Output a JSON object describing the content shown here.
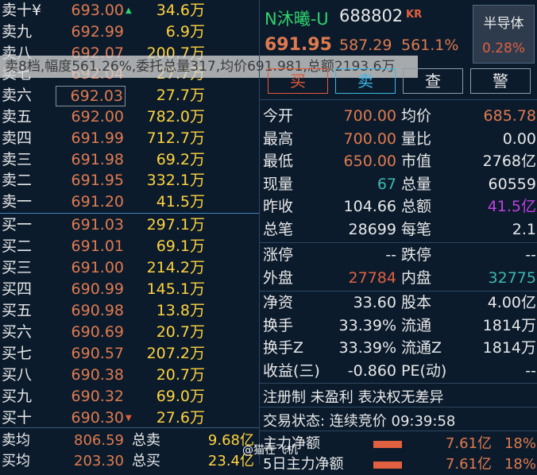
{
  "order_book": {
    "asks": [
      {
        "label": "卖十",
        "price": "693.00",
        "vol": "34.6万"
      },
      {
        "label": "卖九",
        "price": "692.99",
        "vol": "6.9万"
      },
      {
        "label": "卖八",
        "price": "692.07",
        "vol": "200.7万"
      },
      {
        "label": "卖七",
        "price": "692.04",
        "vol": "27.7万"
      },
      {
        "label": "卖六",
        "price": "692.03",
        "vol": "27.7万"
      },
      {
        "label": "卖五",
        "price": "692.00",
        "vol": "782.0万"
      },
      {
        "label": "卖四",
        "price": "691.99",
        "vol": "712.7万"
      },
      {
        "label": "卖三",
        "price": "691.98",
        "vol": "69.2万"
      },
      {
        "label": "卖二",
        "price": "691.95",
        "vol": "332.1万"
      },
      {
        "label": "卖一",
        "price": "691.20",
        "vol": "41.5万"
      }
    ],
    "bids": [
      {
        "label": "买一",
        "price": "691.03",
        "vol": "297.1万"
      },
      {
        "label": "买二",
        "price": "691.01",
        "vol": "69.1万"
      },
      {
        "label": "买三",
        "price": "691.00",
        "vol": "214.2万"
      },
      {
        "label": "买四",
        "price": "690.99",
        "vol": "145.1万"
      },
      {
        "label": "买五",
        "price": "690.98",
        "vol": "13.8万"
      },
      {
        "label": "买六",
        "price": "690.69",
        "vol": "20.7万"
      },
      {
        "label": "买七",
        "price": "690.57",
        "vol": "207.2万"
      },
      {
        "label": "买八",
        "price": "690.38",
        "vol": "20.7万"
      },
      {
        "label": "买九",
        "price": "690.32",
        "vol": "69.0万"
      },
      {
        "label": "买十",
        "price": "690.30",
        "vol": "27.6万"
      }
    ],
    "ask_top_suffix": "¥",
    "footer": [
      {
        "label": "卖均",
        "value": "806.59",
        "label2": "总卖",
        "value2": "9.68亿"
      },
      {
        "label": "买均",
        "value": "203.30",
        "label2": "总买",
        "value2": "23.4亿"
      }
    ]
  },
  "tooltip": "卖8档,幅度561.26%,委托总量317,均价691.981,总额2193.6万",
  "stock": {
    "name": "N沐曦-U",
    "code": "688802",
    "tag": "KR",
    "price": "691.95",
    "change": "587.29",
    "change_pct": "561.1%",
    "sector_name": "半导体",
    "sector_pct": "0.28%"
  },
  "buttons": {
    "buy": "买",
    "sell": "卖",
    "check": "查",
    "alert": "警"
  },
  "stats": [
    {
      "k1": "今开",
      "v1": "700.00",
      "c1": "#e07a4e",
      "k2": "均价",
      "v2": "685.78",
      "c2": "#e07a4e"
    },
    {
      "k1": "最高",
      "v1": "700.00",
      "c1": "#e07a4e",
      "k2": "量比",
      "v2": "0.00",
      "c2": "#e8e8e8"
    },
    {
      "k1": "最低",
      "v1": "650.00",
      "c1": "#e07a4e",
      "k2": "市值",
      "v2": "2768亿",
      "c2": "#e8e8e8"
    },
    {
      "k1": "现量",
      "v1": "67",
      "c1": "#3db7b0",
      "k2": "总量",
      "v2": "60559",
      "c2": "#e8e8e8"
    },
    {
      "k1": "昨收",
      "v1": "104.66",
      "c1": "#e8e8e8",
      "k2": "总额",
      "v2": "41.5亿",
      "c2": "#c040e0"
    },
    {
      "k1": "总笔",
      "v1": "28699",
      "c1": "#e8e8e8",
      "k2": "每笔",
      "v2": "2.1",
      "c2": "#e8e8e8"
    }
  ],
  "limits": [
    {
      "k1": "涨停",
      "v1": "--",
      "c1": "#e8e8e8",
      "k2": "跌停",
      "v2": "--",
      "c2": "#e8e8e8"
    },
    {
      "k1": "外盘",
      "v1": "27784",
      "c1": "#e0603f",
      "k2": "内盘",
      "v2": "32775",
      "c2": "#3db7b0"
    }
  ],
  "fundamentals": [
    {
      "k1": "净资",
      "v1": "33.60",
      "c1": "#e8e8e8",
      "k2": "股本",
      "v2": "4.00亿",
      "c2": "#e8e8e8"
    },
    {
      "k1": "换手",
      "v1": "33.39%",
      "c1": "#e8e8e8",
      "k2": "流通",
      "v2": "1814万",
      "c2": "#e8e8e8"
    },
    {
      "k1": "换手Z",
      "v1": "33.39%",
      "c1": "#e8e8e8",
      "k2": "流通Z",
      "v2": "1814万",
      "c2": "#e8e8e8"
    },
    {
      "k1": "收益(三)",
      "v1": "-0.860",
      "c1": "#e8e8e8",
      "k2": "PE(动)",
      "v2": "--",
      "c2": "#e8e8e8"
    }
  ],
  "notes": {
    "registration": "注册制 未盈利 表决权无差异",
    "status": "交易状态: 连续竞价 09:39:58"
  },
  "flows": [
    {
      "label": "主力净额",
      "value": "7.61亿",
      "pct": "18%"
    },
    {
      "label": "5日主力净额",
      "value": "7.61亿",
      "pct": "18%"
    }
  ],
  "watermark": "@猫在飞机",
  "colors": {
    "up": "#e07a4e",
    "down": "#2fd26d",
    "volume": "#ffd23d",
    "background": "#0b1b2c"
  }
}
